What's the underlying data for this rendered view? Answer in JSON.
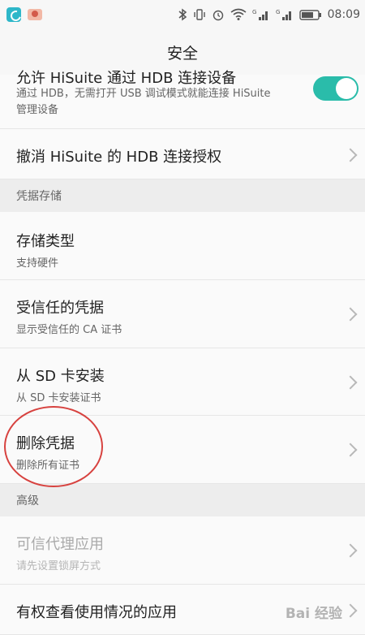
{
  "status_bar": {
    "time": "08:09"
  },
  "title": "安全",
  "top_partial_title": "允许 HiSuite 通过 HDB 连接设备",
  "hdb_row": {
    "subtitle_line1": "通过 HDB，无需打开 USB 调试模式就能连接 HiSuite",
    "subtitle_line2": "管理设备",
    "toggle_on": true
  },
  "revoke_row": {
    "title": "撤消 HiSuite 的 HDB 连接授权"
  },
  "section_credentials": "凭据存储",
  "storage_type": {
    "title": "存储类型",
    "subtitle": "支持硬件"
  },
  "trusted": {
    "title": "受信任的凭据",
    "subtitle": "显示受信任的 CA 证书"
  },
  "install_sd": {
    "title": "从 SD 卡安装",
    "subtitle": "从 SD 卡安装证书"
  },
  "delete_cred": {
    "title": "删除凭据",
    "subtitle": "删除所有证书"
  },
  "section_advanced": "高级",
  "trust_agents": {
    "title": "可信代理应用",
    "subtitle": "请先设置锁屏方式"
  },
  "usage_access": {
    "title": "有权查看使用情况的应用"
  },
  "watermark": "Bai 经验"
}
